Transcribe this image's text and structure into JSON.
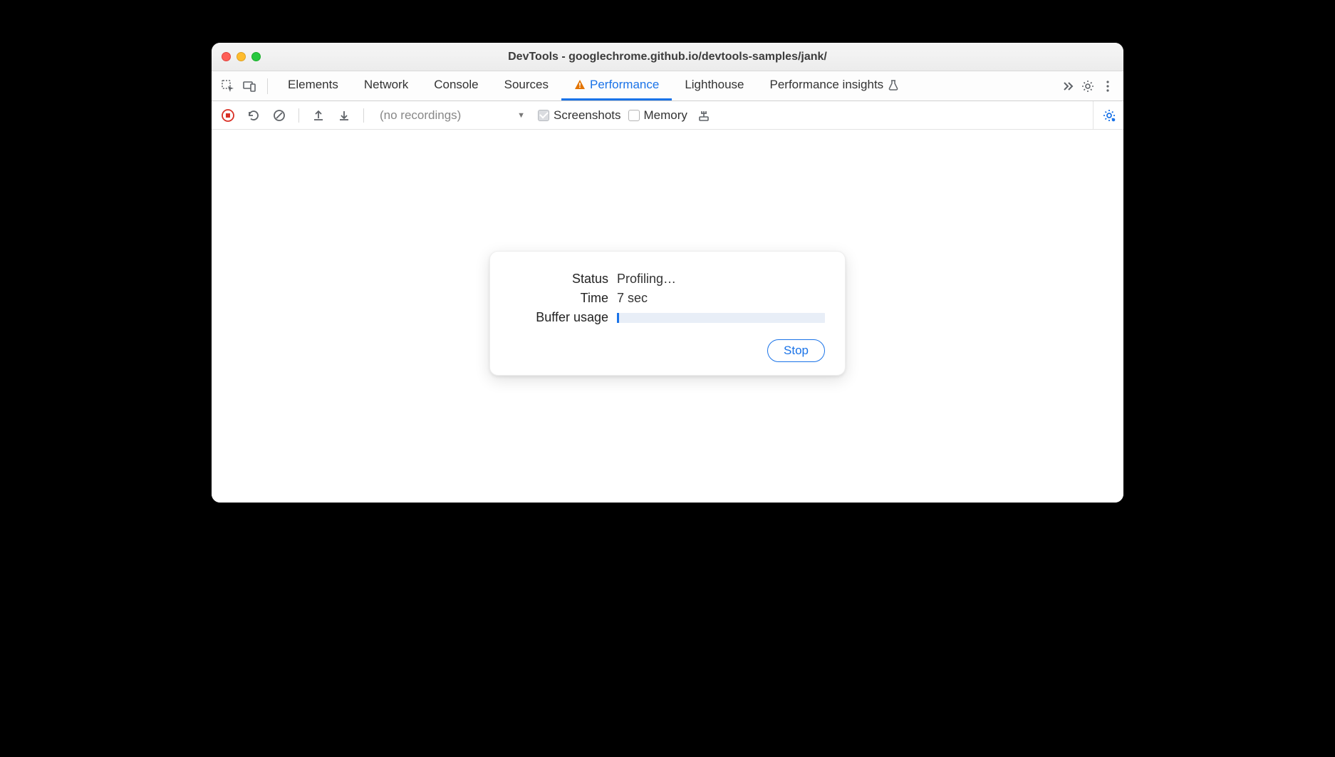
{
  "window": {
    "title": "DevTools - googlechrome.github.io/devtools-samples/jank/"
  },
  "tabs": {
    "items": [
      {
        "label": "Elements"
      },
      {
        "label": "Network"
      },
      {
        "label": "Console"
      },
      {
        "label": "Sources"
      },
      {
        "label": "Performance",
        "active": true,
        "warning": true
      },
      {
        "label": "Lighthouse"
      },
      {
        "label": "Performance insights",
        "flask": true
      }
    ]
  },
  "toolbar": {
    "recordings_placeholder": "(no recordings)",
    "screenshots_label": "Screenshots",
    "screenshots_checked": true,
    "memory_label": "Memory",
    "memory_checked": false
  },
  "dialog": {
    "status_label": "Status",
    "status_value": "Profiling…",
    "time_label": "Time",
    "time_value": "7 sec",
    "buffer_label": "Buffer usage",
    "buffer_percent": 1,
    "stop_label": "Stop"
  }
}
